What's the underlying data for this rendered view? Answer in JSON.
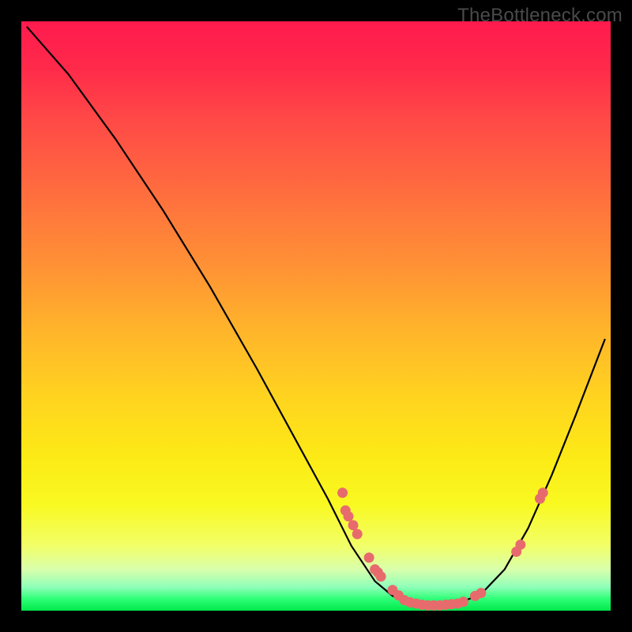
{
  "watermark": "TheBottleneck.com",
  "chart_data": {
    "type": "line",
    "title": "",
    "xlabel": "",
    "ylabel": "",
    "xlim": [
      0,
      100
    ],
    "ylim": [
      0,
      100
    ],
    "curve": [
      {
        "x": 1.0,
        "y": 99.0
      },
      {
        "x": 8.0,
        "y": 91.0
      },
      {
        "x": 16.0,
        "y": 80.0
      },
      {
        "x": 24.0,
        "y": 68.0
      },
      {
        "x": 32.0,
        "y": 55.0
      },
      {
        "x": 40.0,
        "y": 41.0
      },
      {
        "x": 46.0,
        "y": 30.0
      },
      {
        "x": 52.0,
        "y": 19.0
      },
      {
        "x": 56.0,
        "y": 11.0
      },
      {
        "x": 60.0,
        "y": 5.0
      },
      {
        "x": 63.0,
        "y": 2.5
      },
      {
        "x": 66.0,
        "y": 1.2
      },
      {
        "x": 70.0,
        "y": 0.9
      },
      {
        "x": 74.0,
        "y": 1.2
      },
      {
        "x": 78.0,
        "y": 2.8
      },
      {
        "x": 82.0,
        "y": 7.0
      },
      {
        "x": 86.0,
        "y": 14.0
      },
      {
        "x": 90.0,
        "y": 23.0
      },
      {
        "x": 94.0,
        "y": 33.0
      },
      {
        "x": 99.0,
        "y": 46.0
      }
    ],
    "markers": [
      {
        "x": 54.5,
        "y": 20.0
      },
      {
        "x": 55.0,
        "y": 17.0
      },
      {
        "x": 55.5,
        "y": 16.0
      },
      {
        "x": 56.3,
        "y": 14.5
      },
      {
        "x": 57.0,
        "y": 13.0
      },
      {
        "x": 59.0,
        "y": 9.0
      },
      {
        "x": 60.0,
        "y": 7.0
      },
      {
        "x": 60.5,
        "y": 6.5
      },
      {
        "x": 61.0,
        "y": 5.8
      },
      {
        "x": 63.0,
        "y": 3.5
      },
      {
        "x": 64.0,
        "y": 2.6
      },
      {
        "x": 65.0,
        "y": 1.8
      },
      {
        "x": 66.0,
        "y": 1.4
      },
      {
        "x": 67.0,
        "y": 1.2
      },
      {
        "x": 68.0,
        "y": 1.0
      },
      {
        "x": 69.0,
        "y": 0.9
      },
      {
        "x": 70.0,
        "y": 0.9
      },
      {
        "x": 71.0,
        "y": 0.9
      },
      {
        "x": 72.0,
        "y": 1.0
      },
      {
        "x": 73.0,
        "y": 1.1
      },
      {
        "x": 74.0,
        "y": 1.2
      },
      {
        "x": 75.0,
        "y": 1.5
      },
      {
        "x": 77.0,
        "y": 2.5
      },
      {
        "x": 78.0,
        "y": 3.0
      },
      {
        "x": 84.0,
        "y": 10.0
      },
      {
        "x": 84.7,
        "y": 11.2
      },
      {
        "x": 88.0,
        "y": 19.0
      },
      {
        "x": 88.5,
        "y": 20.0
      }
    ],
    "marker_color": "#e76b6d",
    "curve_color": "#000000"
  }
}
